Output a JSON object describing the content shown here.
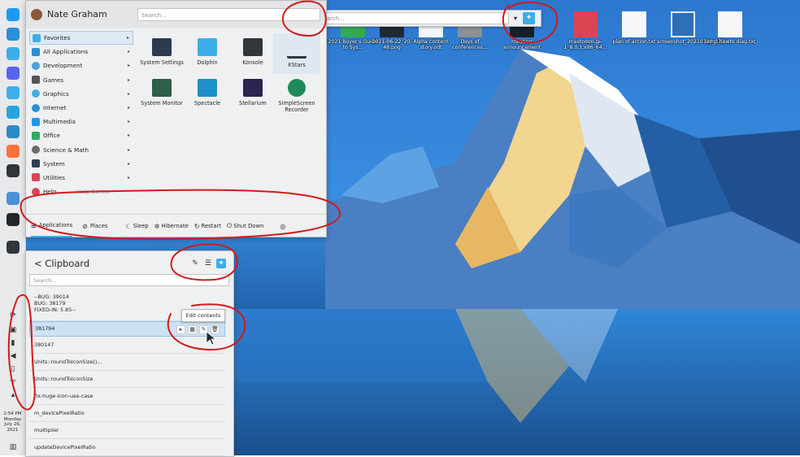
{
  "launcher": {
    "username": "Nate Graham",
    "search_placeholder": "Search...",
    "categories": [
      {
        "label": "Favorites",
        "icon": "favorites-icon",
        "color": "#3daee9"
      },
      {
        "label": "All Applications",
        "icon": "all-applications-icon",
        "color": "#2a8fd6"
      },
      {
        "label": "Development",
        "icon": "development-icon",
        "color": "#4aa3df"
      },
      {
        "label": "Games",
        "icon": "games-icon",
        "color": "#555555"
      },
      {
        "label": "Graphics",
        "icon": "graphics-icon",
        "color": "#3daee9"
      },
      {
        "label": "Internet",
        "icon": "internet-icon",
        "color": "#2a8fd6"
      },
      {
        "label": "Multimedia",
        "icon": "multimedia-icon",
        "color": "#1d99f3"
      },
      {
        "label": "Office",
        "icon": "office-icon",
        "color": "#27ae60"
      },
      {
        "label": "Science & Math",
        "icon": "science-icon",
        "color": "#6b6b6b"
      },
      {
        "label": "System",
        "icon": "system-icon",
        "color": "#2c3e50"
      },
      {
        "label": "Utilities",
        "icon": "utilities-icon",
        "color": "#da4453"
      },
      {
        "label": "Help",
        "icon": "help-icon",
        "color": "#da4453"
      }
    ],
    "help_tooltip": "Help Center",
    "apps": [
      {
        "label": "System Settings",
        "icon": "system-settings-icon"
      },
      {
        "label": "Dolphin",
        "icon": "dolphin-icon"
      },
      {
        "label": "Konsole",
        "icon": "konsole-icon"
      },
      {
        "label": "KStars",
        "icon": "kstars-icon"
      },
      {
        "label": "System Monitor",
        "icon": "system-monitor-icon"
      },
      {
        "label": "Spectacle",
        "icon": "spectacle-icon"
      },
      {
        "label": "Stellarium",
        "icon": "stellarium-icon"
      },
      {
        "label": "SimpleScreen Recorder",
        "icon": "simplescreenrecorder-icon"
      }
    ],
    "footer": {
      "applications": "Applications",
      "places": "Places",
      "sleep": "Sleep",
      "hibernate": "Hibernate",
      "restart": "Restart",
      "shutdown": "Shut Down"
    }
  },
  "clipboard": {
    "title": "Clipboard",
    "search_placeholder": "Search...",
    "items": [
      {
        "lines": [
          "--BUG: 39014",
          "BUG: 38179",
          "FIXED-IN: 5.85--"
        ]
      },
      {
        "lines": [
          "381794"
        ],
        "selected": true
      },
      {
        "lines": [
          "380147"
        ]
      },
      {
        "lines": [
          "Units::roundToIconSize()..."
        ]
      },
      {
        "lines": [
          "Units::roundToIconSize"
        ]
      },
      {
        "lines": [
          "fix-huge-icon-use-case"
        ]
      },
      {
        "lines": [
          "m_devicePixelRatio"
        ]
      },
      {
        "lines": [
          "multiplier"
        ]
      },
      {
        "lines": [
          "updateDevicePixelRatio"
        ]
      }
    ],
    "tooltip": "Edit contents"
  },
  "krunner": {
    "placeholder": "Search..."
  },
  "desktop": {
    "icons": [
      {
        "label": "2021 Buyer's Guide to Sys...",
        "icon": "document-icon"
      },
      {
        "label": "2021-06-22_20-48.png",
        "icon": "image-icon"
      },
      {
        "label": "Alpha content story.odt",
        "icon": "document-icon"
      },
      {
        "label": "Days of conferences...",
        "icon": "image-icon"
      },
      {
        "label": "meeting announcement",
        "icon": "image-icon"
      },
      {
        "label": "mastodon.jp-1_8.0.1.x86_64...",
        "icon": "package-icon"
      },
      {
        "label": "plan of action.txt",
        "icon": "text-icon"
      },
      {
        "label": "screenshot_20210723_173...",
        "icon": "image-icon"
      },
      {
        "label": "temp howto diag.txt",
        "icon": "text-icon"
      }
    ]
  },
  "panel": {
    "clock": [
      "2:54 PM",
      "Monday",
      "July 26,",
      "2021"
    ],
    "launchers": [
      {
        "icon": "app-launcher-icon",
        "color": "#1d99f3"
      },
      {
        "icon": "system-settings-icon",
        "color": "#2a8fd6"
      },
      {
        "icon": "dolphin-icon",
        "color": "#3daee9"
      },
      {
        "icon": "discord-icon",
        "color": "#5865f2"
      },
      {
        "icon": "konversation-icon",
        "color": "#3daee9"
      },
      {
        "icon": "telegram-icon",
        "color": "#2aa3df"
      },
      {
        "icon": "okular-icon",
        "color": "#2d88c8"
      },
      {
        "icon": "firefox-icon",
        "color": "#ff7139"
      },
      {
        "icon": "konsole-icon",
        "color": "#31363b"
      },
      {
        "icon": "chromium-icon",
        "color": "#4a90d9"
      },
      {
        "icon": "terminal-icon",
        "color": "#232629"
      }
    ]
  },
  "colors": {
    "accent": "#3daee9",
    "annotation": "#d11a1a"
  }
}
